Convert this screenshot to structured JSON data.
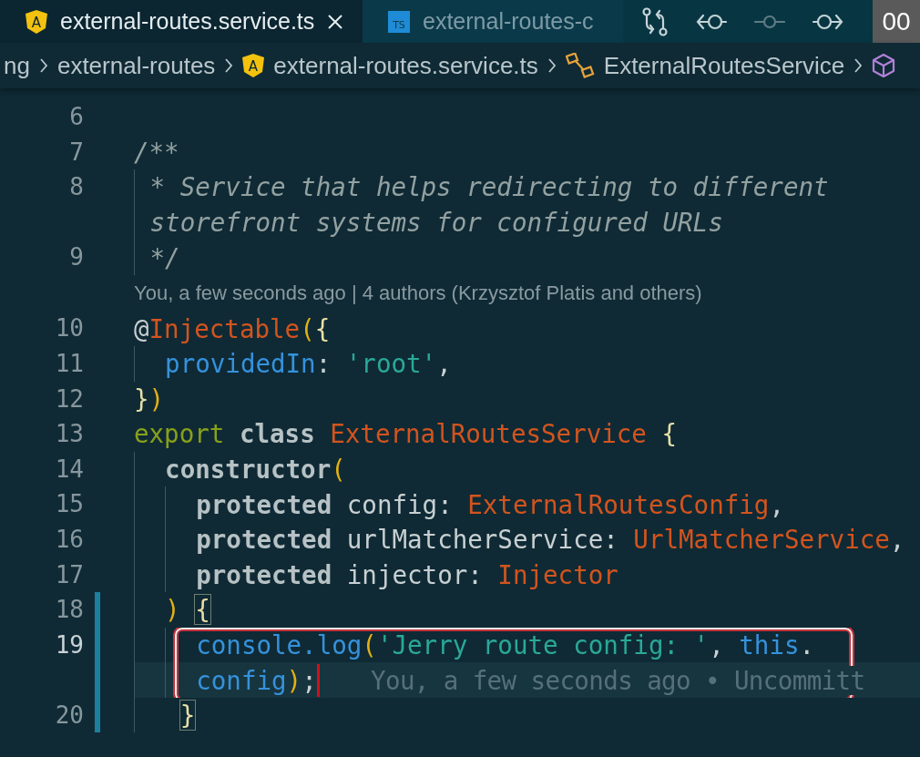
{
  "tabs": [
    {
      "label": "external-routes.service.ts",
      "kind": "angular",
      "badge": "A",
      "selected": true,
      "closable": true
    },
    {
      "label": "external-routes-c",
      "kind": "ts",
      "badge": "TS",
      "selected": false,
      "closable": false
    }
  ],
  "toolbar": [
    {
      "kind": "compare",
      "disabled": false
    },
    {
      "kind": "back",
      "disabled": false
    },
    {
      "kind": "commit",
      "disabled": true
    },
    {
      "kind": "forward",
      "disabled": false
    }
  ],
  "corner_panel": {
    "text": "00"
  },
  "breadcrumbs": [
    {
      "label": "ng",
      "kind": "folder"
    },
    {
      "label": "external-routes",
      "kind": "folder"
    },
    {
      "label": "external-routes.service.ts",
      "kind": "angular",
      "badge": "A"
    },
    {
      "label": "ExternalRoutesService",
      "kind": "class"
    },
    {
      "kind": "symbol"
    }
  ],
  "lines": [
    {
      "kind": "code",
      "number": "6",
      "modified": false,
      "current": false,
      "outlined": false,
      "rows": [
        {
          "tokens": []
        }
      ]
    },
    {
      "kind": "code",
      "number": "7",
      "modified": false,
      "current": false,
      "outlined": false,
      "rows": [
        {
          "tokens": [
            {
              "kind": "comment",
              "t": "/**"
            }
          ]
        }
      ]
    },
    {
      "kind": "code",
      "number": "8",
      "modified": false,
      "current": false,
      "outlined": false,
      "rows": [
        {
          "tokens": [
            {
              "kind": "half"
            },
            {
              "kind": "comment",
              "t": "* Service that helps redirecting to different"
            }
          ]
        },
        {
          "tokens": [
            {
              "kind": "half"
            },
            {
              "kind": "comment",
              "t": "storefront systems for configured URLs"
            }
          ]
        }
      ]
    },
    {
      "kind": "code",
      "number": "9",
      "modified": false,
      "current": false,
      "outlined": false,
      "rows": [
        {
          "tokens": [
            {
              "kind": "half"
            },
            {
              "kind": "comment",
              "t": "*/"
            }
          ]
        }
      ]
    },
    {
      "kind": "codelens",
      "text": "You, a few seconds ago | 4 authors (Krzysztof Platis and others)"
    },
    {
      "kind": "code",
      "number": "10",
      "modified": false,
      "current": false,
      "outlined": false,
      "rows": [
        {
          "tokens": [
            {
              "kind": "plain",
              "t": "@"
            },
            {
              "kind": "type",
              "t": "Injectable"
            },
            {
              "kind": "paren",
              "t": "("
            },
            {
              "kind": "brace",
              "t": "{"
            }
          ]
        }
      ]
    },
    {
      "kind": "code",
      "number": "11",
      "modified": false,
      "current": false,
      "outlined": false,
      "rows": [
        {
          "tokens": [
            {
              "kind": "indent"
            },
            {
              "kind": "prop",
              "t": "providedIn"
            },
            {
              "kind": "plain",
              "t": ":"
            },
            {
              "kind": "string",
              "t": " 'root'"
            },
            {
              "kind": "plain",
              "t": ","
            }
          ]
        }
      ]
    },
    {
      "kind": "code",
      "number": "12",
      "modified": false,
      "current": false,
      "outlined": false,
      "rows": [
        {
          "tokens": [
            {
              "kind": "brace",
              "t": "}"
            },
            {
              "kind": "paren",
              "t": ")"
            }
          ]
        }
      ]
    },
    {
      "kind": "code",
      "number": "13",
      "modified": false,
      "current": false,
      "outlined": false,
      "rows": [
        {
          "tokens": [
            {
              "kind": "export",
              "t": "export"
            },
            {
              "kind": "storage",
              "t": " class"
            },
            {
              "kind": "type",
              "t": " ExternalRoutesService"
            },
            {
              "kind": "brace",
              "t": " {"
            }
          ]
        }
      ]
    },
    {
      "kind": "code",
      "number": "14",
      "modified": false,
      "current": false,
      "outlined": false,
      "rows": [
        {
          "tokens": [
            {
              "kind": "indent"
            },
            {
              "kind": "storage",
              "t": "constructor"
            },
            {
              "kind": "paren",
              "t": "("
            }
          ]
        }
      ]
    },
    {
      "kind": "code",
      "number": "15",
      "modified": false,
      "current": false,
      "outlined": false,
      "rows": [
        {
          "tokens": [
            {
              "kind": "indent"
            },
            {
              "kind": "indent"
            },
            {
              "kind": "storage",
              "t": "protected"
            },
            {
              "kind": "plain",
              "t": " config"
            },
            {
              "kind": "punct",
              "t": ":"
            },
            {
              "kind": "type",
              "t": " ExternalRoutesConfig"
            },
            {
              "kind": "plain",
              "t": ","
            }
          ]
        }
      ]
    },
    {
      "kind": "code",
      "number": "16",
      "modified": false,
      "current": false,
      "outlined": false,
      "rows": [
        {
          "tokens": [
            {
              "kind": "indent"
            },
            {
              "kind": "indent"
            },
            {
              "kind": "storage",
              "t": "protected"
            },
            {
              "kind": "plain",
              "t": " urlMatcherService"
            },
            {
              "kind": "punct",
              "t": ":"
            },
            {
              "kind": "type",
              "t": " UrlMatcherService"
            },
            {
              "kind": "plain",
              "t": ","
            }
          ]
        }
      ]
    },
    {
      "kind": "code",
      "number": "17",
      "modified": false,
      "current": false,
      "outlined": false,
      "rows": [
        {
          "tokens": [
            {
              "kind": "indent"
            },
            {
              "kind": "indent"
            },
            {
              "kind": "storage",
              "t": "protected"
            },
            {
              "kind": "plain",
              "t": " injector"
            },
            {
              "kind": "punct",
              "t": ":"
            },
            {
              "kind": "type",
              "t": " Injector"
            }
          ]
        }
      ]
    },
    {
      "kind": "code",
      "number": "18",
      "modified": true,
      "current": false,
      "outlined": false,
      "rows": [
        {
          "tokens": [
            {
              "kind": "indent"
            },
            {
              "kind": "paren",
              "t": ")"
            },
            {
              "kind": "brace-match",
              "t": "{"
            }
          ]
        }
      ]
    },
    {
      "kind": "code",
      "number": "19",
      "modified": true,
      "current": true,
      "outlined": true,
      "rows": [
        {
          "tokens": [
            {
              "kind": "indent"
            },
            {
              "kind": "indent"
            },
            {
              "kind": "prop",
              "t": "console.log"
            },
            {
              "kind": "paren",
              "t": "("
            },
            {
              "kind": "string",
              "t": "'Jerry route config: '"
            },
            {
              "kind": "plain",
              "t": ","
            },
            {
              "kind": "prop",
              "t": " this"
            },
            {
              "kind": "plain",
              "t": "."
            }
          ]
        },
        {
          "tokens": [
            {
              "kind": "indent"
            },
            {
              "kind": "indent"
            },
            {
              "kind": "prop",
              "t": "config"
            },
            {
              "kind": "paren",
              "t": ")"
            },
            {
              "kind": "plain",
              "t": ";"
            },
            {
              "kind": "cursor"
            },
            {
              "kind": "blame",
              "t": "You, a few seconds ago • Uncommitt"
            }
          ]
        }
      ]
    },
    {
      "kind": "code",
      "number": "20",
      "modified": true,
      "current": false,
      "outlined": false,
      "rows": [
        {
          "tokens": [
            {
              "kind": "indent"
            },
            {
              "kind": "brace-match",
              "t": "}"
            }
          ]
        }
      ]
    }
  ]
}
